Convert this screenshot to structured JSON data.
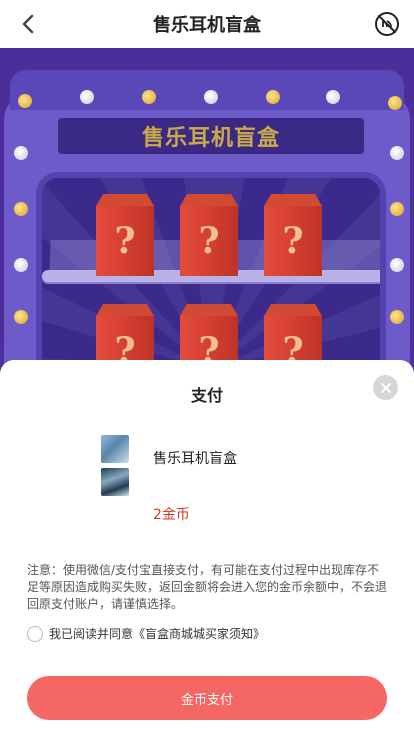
{
  "nav": {
    "title": "售乐耳机盲盒",
    "back_icon": "chevron-left-icon",
    "mute_icon": "sound-off-icon"
  },
  "machine": {
    "sign_text": "售乐耳机盲盒",
    "box_mark": "?"
  },
  "payment": {
    "title": "支付",
    "product_name": "售乐耳机盲盒",
    "price": "2金币",
    "notice": "注意：使用微信/支付宝直接支付，有可能在支付过程中出现库存不足等原因造成购买失败，返回金额将会进入您的金币余额中，不会退回原支付账户，请谨慎选择。",
    "agreement": "我已阅读并同意《盲盒商城城买家须知》",
    "pay_button": "金币支付",
    "close_icon": "close-icon"
  },
  "colors": {
    "accent": "#f46764",
    "price": "#d33a2a",
    "machine_bg": "#4a2f9a"
  }
}
